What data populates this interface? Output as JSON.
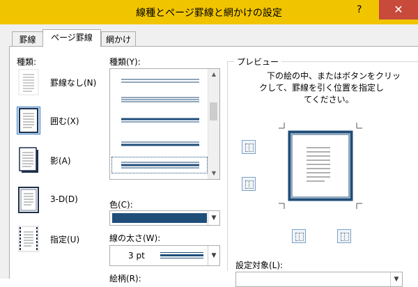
{
  "window": {
    "title": "線種とページ罫線と網かけの設定",
    "help_label": "?",
    "close_label": "✕"
  },
  "tabs": [
    {
      "label": "罫線"
    },
    {
      "label": "ページ罫線"
    },
    {
      "label": "網かけ"
    }
  ],
  "settings": {
    "heading": "種類:",
    "items": [
      {
        "label": "罫線なし(N)"
      },
      {
        "label": "囲む(X)"
      },
      {
        "label": "影(A)"
      },
      {
        "label": "3-D(D)"
      },
      {
        "label": "指定(U)"
      }
    ],
    "selected_index": 1
  },
  "style": {
    "heading": "種類(Y):",
    "selected_index": 4,
    "color_label": "色(C):",
    "color_value": "#1f4e79",
    "width_label": "線の太さ(W):",
    "width_value": "3 pt",
    "art_label": "絵柄(R):"
  },
  "preview": {
    "heading": "プレビュー",
    "instruction_lines": [
      "下の絵の中、またはボタンをクリッ",
      "クして、罫線を引く位置を指定し",
      "てください。"
    ],
    "border_color": "#1f4e79",
    "apply_to_label": "設定対象(L):"
  },
  "colors": {
    "title_bar": "#f1c400",
    "close_button": "#c74a3b",
    "selection": "#1f4e79",
    "dialog_bg": "#f0f0f0"
  }
}
